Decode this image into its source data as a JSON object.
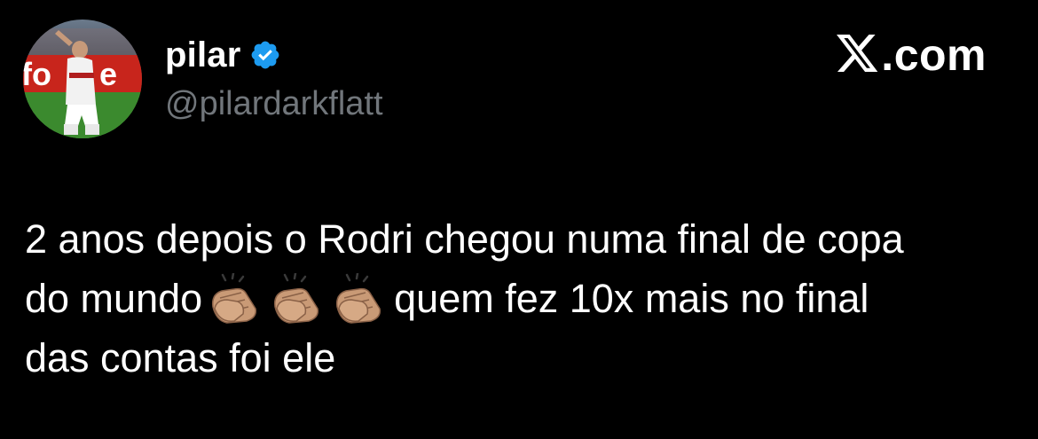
{
  "author": {
    "display_name": "pilar",
    "handle": "@pilardarkflatt",
    "verified": true,
    "verified_color": "#1d9bf0"
  },
  "brand": {
    "icon": "x-logo-icon",
    "text": ".com"
  },
  "tweet": {
    "line1": "2 anos depois o Rodri chegou numa final de copa",
    "line2_start": "do mundo",
    "line2_emoji": [
      "clapping-hands-icon",
      "clapping-hands-icon",
      "clapping-hands-icon"
    ],
    "line2_end": "quem fez 10x mais no final",
    "line3": "das contas foi ele"
  },
  "colors": {
    "background": "#000000",
    "text_primary": "#ffffff",
    "text_secondary": "#71767b"
  }
}
